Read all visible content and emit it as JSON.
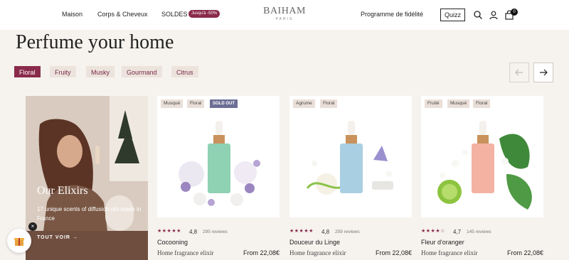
{
  "header": {
    "nav_maison": "Maison",
    "nav_corps": "Corps & Cheveux",
    "nav_soldes": "SOLDES",
    "sale_badge": "Jusqu'à -50%",
    "logo": "BAIHAM",
    "logo_sub": "PARIS",
    "nav_fidelite": "Programme de fidélité",
    "quizz": "Quizz",
    "cart_count": "0"
  },
  "title": "Perfume your home",
  "filters": [
    {
      "label": "Floral",
      "active": true
    },
    {
      "label": "Fruity",
      "active": false
    },
    {
      "label": "Musky",
      "active": false
    },
    {
      "label": "Gourmand",
      "active": false
    },
    {
      "label": "Citrus",
      "active": false
    }
  ],
  "promo": {
    "title": "Our Elixirs",
    "text": "17 unique scents of diffusion oils made in France",
    "link": "TOUT VOIR →"
  },
  "products": [
    {
      "tags": [
        "Musqué",
        "Floral"
      ],
      "sold_out": "SOLD OUT",
      "stars": "★★★★★",
      "rating": "4,8",
      "reviews": "295 reviews",
      "name": "Cocooning",
      "desc": "Home fragrance elixir",
      "price": "From 22,08€",
      "bottle_color": "#8fd1b3"
    },
    {
      "tags": [
        "Agrume",
        "Floral"
      ],
      "stars": "★★★★★",
      "rating": "4,8",
      "reviews": "259 reviews",
      "name": "Douceur du Linge",
      "desc": "Home fragrance elixir",
      "price": "From 22,08€",
      "bottle_color": "#a9cfe3"
    },
    {
      "tags": [
        "Fruité",
        "Musqué",
        "Floral"
      ],
      "stars": "★★★★☆",
      "rating": "4,7",
      "reviews": "145 reviews",
      "name": "Fleur d'oranger",
      "desc": "Home fragrance elixir",
      "price": "From 22,08€",
      "bottle_color": "#f4b2a3"
    }
  ],
  "colors": {
    "accent": "#8a2a4a",
    "chip_bg": "#ece3dc",
    "page_bg": "#f6f3ef"
  }
}
